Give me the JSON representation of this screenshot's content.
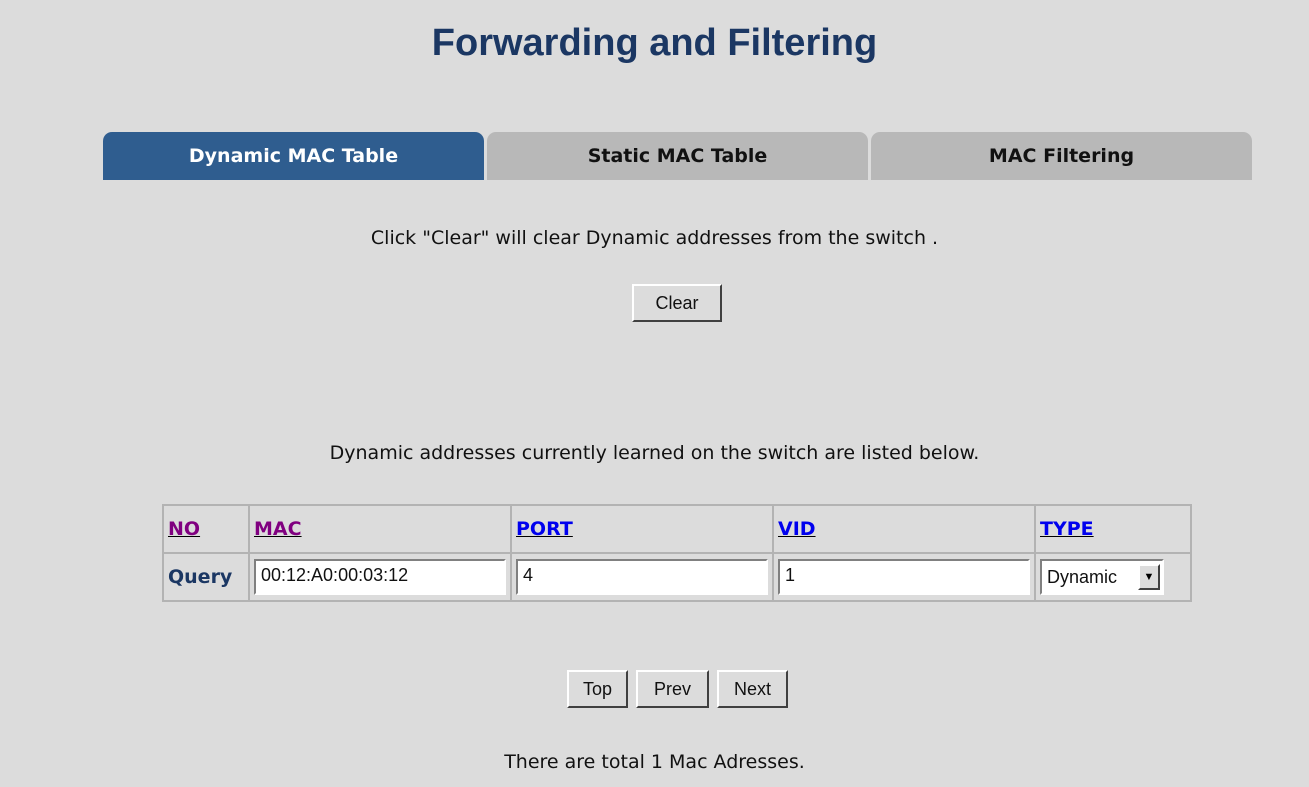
{
  "page": {
    "title": "Forwarding and Filtering"
  },
  "tabs": [
    {
      "label": "Dynamic MAC Table",
      "active": true
    },
    {
      "label": "Static MAC Table",
      "active": false
    },
    {
      "label": "MAC Filtering",
      "active": false
    }
  ],
  "clear_section": {
    "message": "Click \"Clear\" will clear Dynamic addresses from the switch .",
    "button_label": "Clear"
  },
  "list_message": "Dynamic addresses currently learned on the switch are listed below.",
  "table": {
    "headers": [
      "NO",
      "MAC",
      "PORT",
      "VID",
      "TYPE"
    ],
    "query_label": "Query",
    "query_values": {
      "mac": "00:12:A0:00:03:12",
      "port": "4",
      "vid": "1",
      "type": "Dynamic"
    }
  },
  "pagination": {
    "top": "Top",
    "prev": "Prev",
    "next": "Next"
  },
  "footer_text": "There are total 1 Mac Adresses.",
  "colors": {
    "background": "#dcdcdc",
    "title": "#1b3763",
    "active_tab": "#2f5d8f",
    "inactive_tab": "#b8b8b8"
  }
}
